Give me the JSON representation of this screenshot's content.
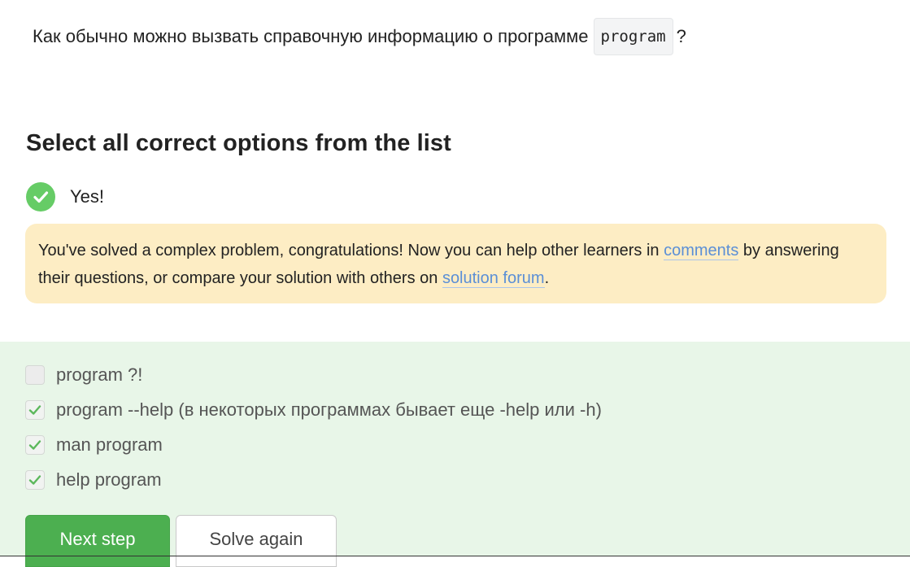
{
  "question": {
    "text_before": "Как обычно можно вызвать справочную информацию о программе",
    "code": "program",
    "text_after": "?"
  },
  "title": "Select all correct options from the list",
  "status": {
    "text": "Yes!",
    "color": "#66cc66"
  },
  "notice": {
    "part1": "You've solved a complex problem, congratulations! Now you can help other learners in ",
    "link1": "comments",
    "part2": " by answering their questions, or compare your solution with others on ",
    "link2": "solution forum",
    "part3": "."
  },
  "options": [
    {
      "label": "program ?!",
      "checked": false
    },
    {
      "label": "program --help (в некоторых программах бывает еще -help или -h)",
      "checked": true
    },
    {
      "label": "man program",
      "checked": true
    },
    {
      "label": "help program",
      "checked": true
    }
  ],
  "buttons": {
    "next": "Next step",
    "solve_again": "Solve again"
  },
  "colors": {
    "accent_green": "#4caf50",
    "notice_bg": "#fdedc4",
    "answers_bg": "#e8f6e8",
    "link": "#5b8fd6"
  }
}
